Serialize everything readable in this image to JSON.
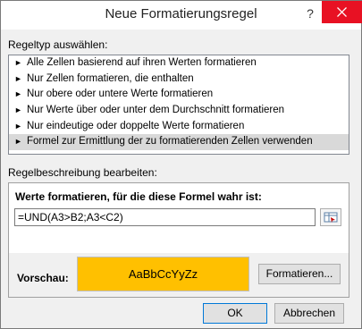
{
  "window": {
    "title": "Neue Formatierungsregel",
    "help_label": "?",
    "close_icon": "close-icon"
  },
  "rule_type": {
    "label": "Regeltyp auswählen:",
    "items": [
      {
        "label": "Alle Zellen basierend auf ihren Werten formatieren",
        "selected": false
      },
      {
        "label": "Nur Zellen formatieren, die enthalten",
        "selected": false
      },
      {
        "label": "Nur obere oder untere Werte formatieren",
        "selected": false
      },
      {
        "label": "Nur Werte über oder unter dem Durchschnitt formatieren",
        "selected": false
      },
      {
        "label": "Nur eindeutige oder doppelte Werte formatieren",
        "selected": false
      },
      {
        "label": "Formel zur Ermittlung der zu formatierenden Zellen verwenden",
        "selected": true
      }
    ],
    "arrow_glyph": "►"
  },
  "rule_description": {
    "label": "Regelbeschreibung bearbeiten:",
    "formula_heading": "Werte formatieren, für die diese Formel wahr ist:",
    "formula_value": "=UND(A3>B2;A3<C2)",
    "preview_label": "Vorschau:",
    "preview_text": "AaBbCcYyZz",
    "preview_color": "#ffc000",
    "format_button": "Formatieren..."
  },
  "footer": {
    "ok_label": "OK",
    "cancel_label": "Abbrechen"
  }
}
